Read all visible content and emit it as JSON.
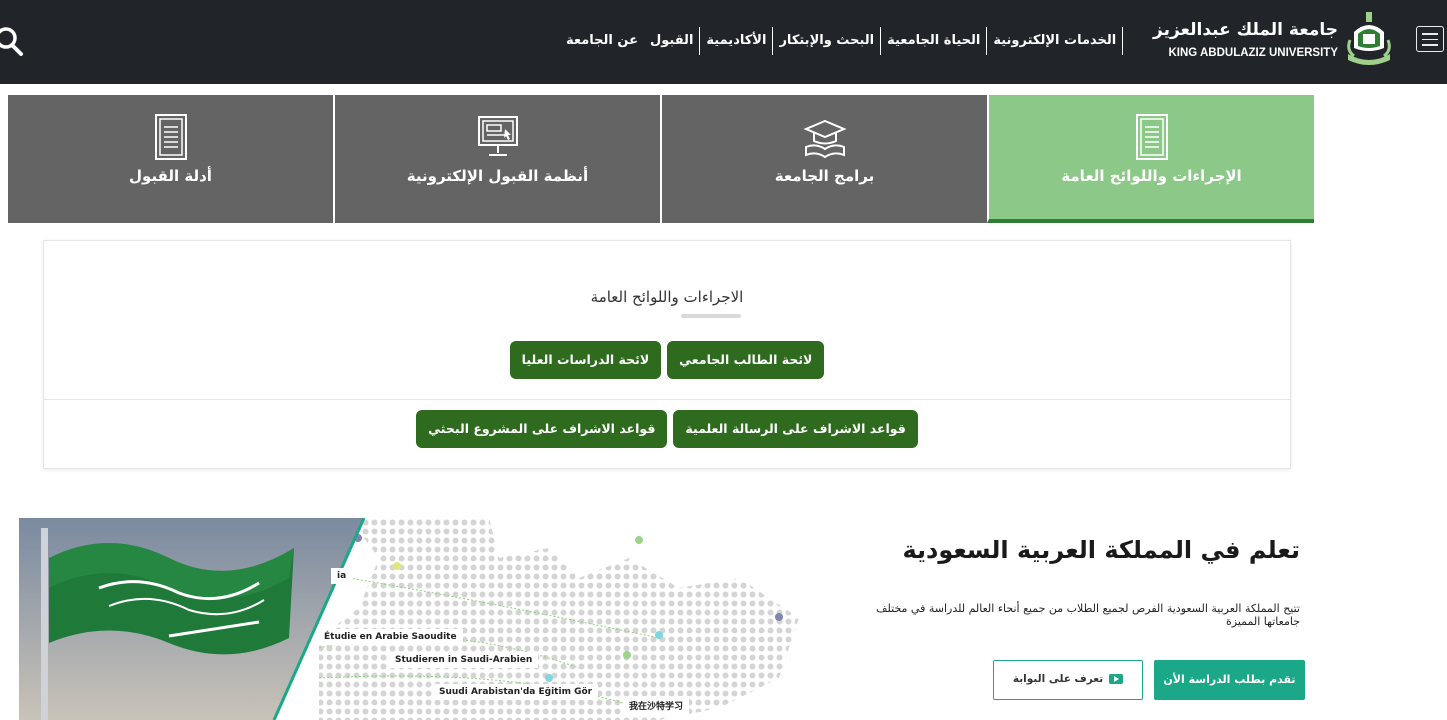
{
  "navbar": {
    "search_icon": "search-icon",
    "menu_icon": "hamburger-menu-icon",
    "brand_ar": "جامعة الملك عبدالعزيز",
    "brand_en": "KING ABDULAZIZ UNIVERSITY",
    "menu": [
      "عن الجامعة",
      "القبول",
      "الأكاديمية",
      "البحث والإبتكار",
      "الحياة الجامعية",
      "الخدمات الإلكترونية"
    ]
  },
  "tabs": [
    {
      "label": "الإجراءات واللوائح العامة",
      "icon": "document-icon",
      "active": true
    },
    {
      "label": "برامج الجامعة",
      "icon": "graduation-cap-book-icon",
      "active": false
    },
    {
      "label": "أنظمة القبول الإلكترونية",
      "icon": "computer-monitor-icon",
      "active": false
    },
    {
      "label": "أدلة القبول",
      "icon": "document-icon",
      "active": false
    }
  ],
  "regulations": {
    "title": "الاجراءات واللوائح العامة",
    "row1": [
      "لائحة الطالب الجامعي",
      "لائحة الدراسات العليا"
    ],
    "row2": [
      "قواعد الاشراف على الرسالة العلمية",
      "قواعد الاشراف على المشروع البحثي"
    ]
  },
  "hero": {
    "title": "تعلم في المملكة العربية السعودية",
    "description": "تتيح المملكة العربية السعودية الفرص لجميع الطلاب من جميع أنحاء العالم للدراسة في مختلف جامعاتها المميزة",
    "apply_label": "تقدم بطلب الدراسة الأن",
    "portal_label": "تعرف على البوابة",
    "flag_text": "لا إله إلا الله محمد رسول الله",
    "image_labels": [
      "Étudie en Arabie Saoudite",
      "Studieren in Saudi-Arabien",
      "Suudi Arabistan'da Eğitim Gör",
      "我在沙特学习",
      "ia"
    ]
  },
  "colors": {
    "navbar": "#212529",
    "tab_inactive": "#646464",
    "tab_active": "#8cc887",
    "button_green": "#2e6b1e",
    "accent_teal": "#1aa888"
  }
}
